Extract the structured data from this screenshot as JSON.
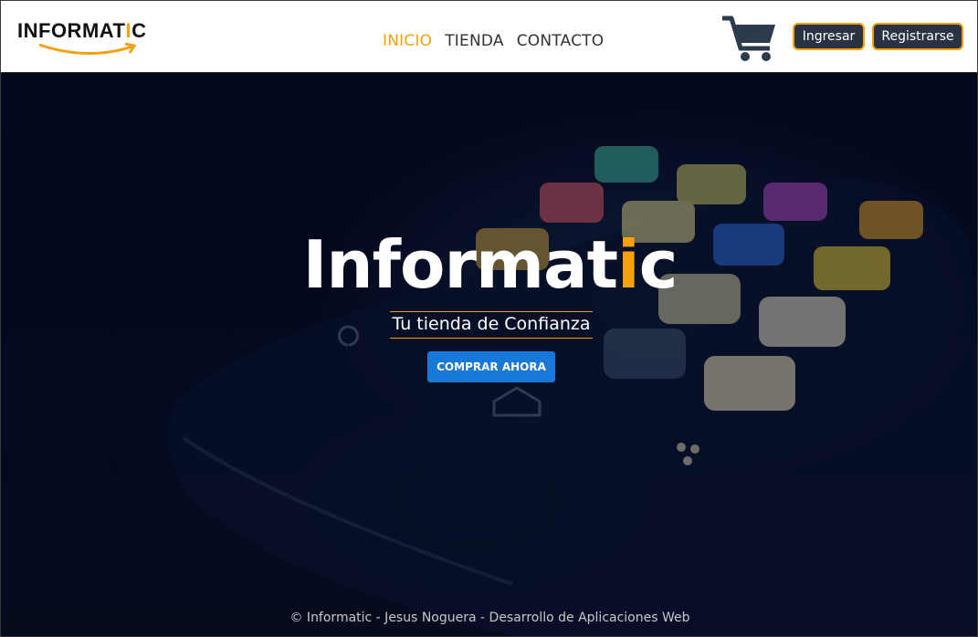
{
  "brand": {
    "logo_main": "INFORMAT",
    "logo_accent_i": "I",
    "logo_end": "C"
  },
  "nav": {
    "links": [
      {
        "label": "INICIO",
        "active": true
      },
      {
        "label": "TIENDA",
        "active": false
      },
      {
        "label": "CONTACTO",
        "active": false
      }
    ],
    "cart_icon": "shopping-cart-icon",
    "login_label": "Ingresar",
    "register_label": "Registrarse"
  },
  "hero": {
    "title_main": "Informat",
    "title_accent": "i",
    "title_end": "c",
    "subtitle": "Tu tienda de Confianza",
    "cta_label": "COMPRAR AHORA"
  },
  "footer": {
    "text": "© Informatic - Jesus Noguera - Desarrollo de Aplicaciones Web"
  },
  "colors": {
    "accent": "#f5a10a",
    "cta": "#1778d8",
    "nav_button": "#2a3344"
  }
}
